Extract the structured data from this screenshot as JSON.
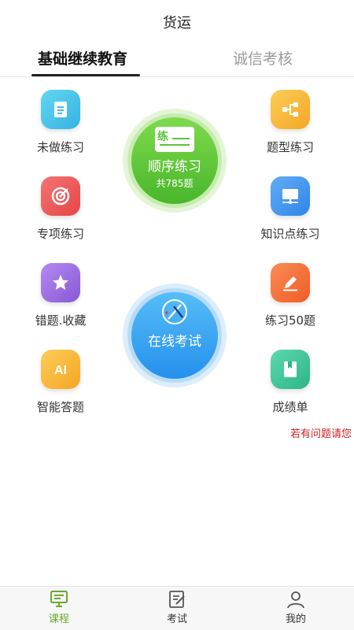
{
  "header": {
    "title": "货运"
  },
  "tabs": [
    {
      "label": "基础继续教育",
      "active": true
    },
    {
      "label": "诚信考核",
      "active": false
    }
  ],
  "grid": {
    "left": [
      {
        "label": "未做练习",
        "icon": "document-icon",
        "color": "#4cc3e8"
      },
      {
        "label": "专项练习",
        "icon": "target-icon",
        "color": "#ee5a5a"
      },
      {
        "label": "错题.收藏",
        "icon": "star-icon",
        "color": "#9e6fe0"
      },
      {
        "label": "智能答题",
        "icon": "ai-icon",
        "color": "#f9b93c"
      }
    ],
    "right": [
      {
        "label": "题型练习",
        "icon": "flowchart-icon",
        "color": "#f9b93c"
      },
      {
        "label": "知识点练习",
        "icon": "monitor-icon",
        "color": "#3f95ef"
      },
      {
        "label": "练习50题",
        "icon": "pencil-icon",
        "color": "#f7703a"
      },
      {
        "label": "成绩单",
        "icon": "book-icon",
        "color": "#3ec79a"
      }
    ]
  },
  "sequence_practice": {
    "badge": "练",
    "title": "顺序练习",
    "subtitle": "共785题",
    "color": "#5ac43a"
  },
  "online_exam": {
    "title": "在线考试",
    "color": "#38a2f2"
  },
  "notice": "若有问题请您",
  "bottom_nav": [
    {
      "label": "课程",
      "icon": "monitor-icon",
      "active": true,
      "active_color": "#6aa82d"
    },
    {
      "label": "考试",
      "icon": "exam-icon",
      "active": false
    },
    {
      "label": "我的",
      "icon": "person-icon",
      "active": false
    }
  ]
}
